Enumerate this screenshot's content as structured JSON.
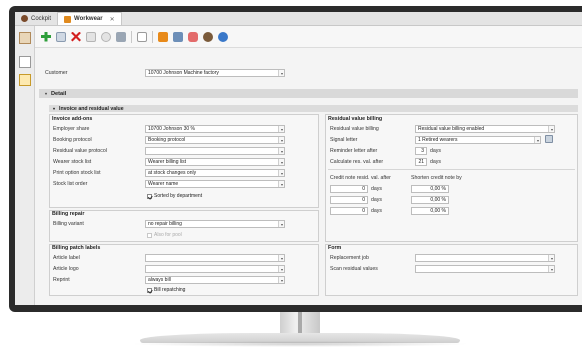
{
  "tabs": [
    {
      "label": "Cockpit",
      "active": false
    },
    {
      "label": "Workwear",
      "active": true
    }
  ],
  "customer": {
    "label": "Customer",
    "value": "10700    Johnson Machine factory"
  },
  "sections": {
    "detail": "Detail",
    "invoice": "Invoice and residual value"
  },
  "invoice_addons": {
    "title": "Invoice add-ons",
    "employer_share": {
      "label": "Employer share",
      "value": "10700    Johnson 30 %"
    },
    "booking_protocol": {
      "label": "Booking protocol",
      "value": "Booking protocol"
    },
    "residual_value_protocol": {
      "label": "Residual value protocol",
      "value": ""
    },
    "wearer_stock_list": {
      "label": "Wearer stock list",
      "value": "Wearer billing list"
    },
    "print_option_stock_list": {
      "label": "Print option stock list",
      "value": "at stock changes only"
    },
    "stock_list_order": {
      "label": "Stock list order",
      "value": "Wearer name"
    },
    "sorted_by_department": {
      "label": "Sorted by department",
      "checked": true
    }
  },
  "billing_repair": {
    "title": "Billing repair",
    "billing_variant": {
      "label": "Billing variant",
      "value": "no repair billing"
    },
    "also_for_pool": {
      "label": "Also for pool",
      "checked": false
    }
  },
  "billing_patch_labels": {
    "title": "Billing patch labels",
    "article_label": {
      "label": "Article label",
      "value": ""
    },
    "article_logo": {
      "label": "Article logo",
      "value": ""
    },
    "reprint": {
      "label": "Reprint",
      "value": "always bill"
    },
    "bill_repatching": {
      "label": "Bill repatching",
      "checked": true
    }
  },
  "residual_value_billing": {
    "title": "Residual value billing",
    "residual_value_billing": {
      "label": "Residual value billing",
      "value": "Residual value billing enabled"
    },
    "signal_letter": {
      "label": "Signal letter",
      "value": "1    Retired wearers"
    },
    "reminder_letter_after": {
      "label": "Reminder letter after",
      "value": "3",
      "unit": "days"
    },
    "calculate_res_val_after": {
      "label": "Calculate res. val. after",
      "value": "21",
      "unit": "days"
    },
    "credit_note_header": "Credit note resid. val. after",
    "shorten_credit_header": "Shorten credit note by",
    "credit_rows": [
      {
        "days": "0",
        "unit": "days",
        "percent": "0,00 %"
      },
      {
        "days": "0",
        "unit": "days",
        "percent": "0,00 %"
      },
      {
        "days": "0",
        "unit": "days",
        "percent": "0,00 %"
      }
    ]
  },
  "form": {
    "title": "Form",
    "replacement_job": {
      "label": "Replacement job",
      "value": ""
    },
    "scan_residual_values": {
      "label": "Scan residual values",
      "value": ""
    }
  },
  "colors": {
    "accent_green": "#2e9e3a",
    "delete_red": "#d32020",
    "tab_icon_orange": "#e08a1e"
  }
}
